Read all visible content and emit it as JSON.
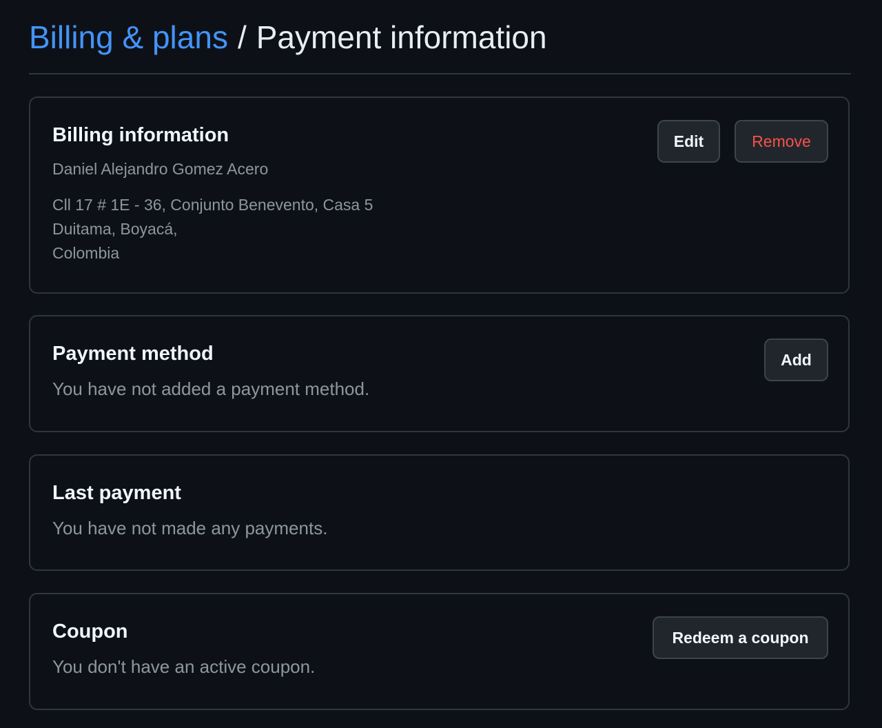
{
  "breadcrumb": {
    "parent": "Billing & plans",
    "separator": "/",
    "current": "Payment information"
  },
  "billing": {
    "title": "Billing information",
    "name": "Daniel Alejandro Gomez Acero",
    "address_lines": [
      "Cll 17 # 1E - 36, Conjunto Benevento, Casa 5",
      "Duitama, Boyacá,",
      "Colombia"
    ],
    "edit_label": "Edit",
    "remove_label": "Remove"
  },
  "payment_method": {
    "title": "Payment method",
    "text": "You have not added a payment method.",
    "add_label": "Add"
  },
  "last_payment": {
    "title": "Last payment",
    "text": "You have not made any payments."
  },
  "coupon": {
    "title": "Coupon",
    "text": "You don't have an active coupon.",
    "redeem_label": "Redeem a coupon"
  },
  "colors": {
    "background": "#0d1117",
    "link": "#4493f8",
    "danger": "#f85149",
    "border": "#30363d"
  }
}
